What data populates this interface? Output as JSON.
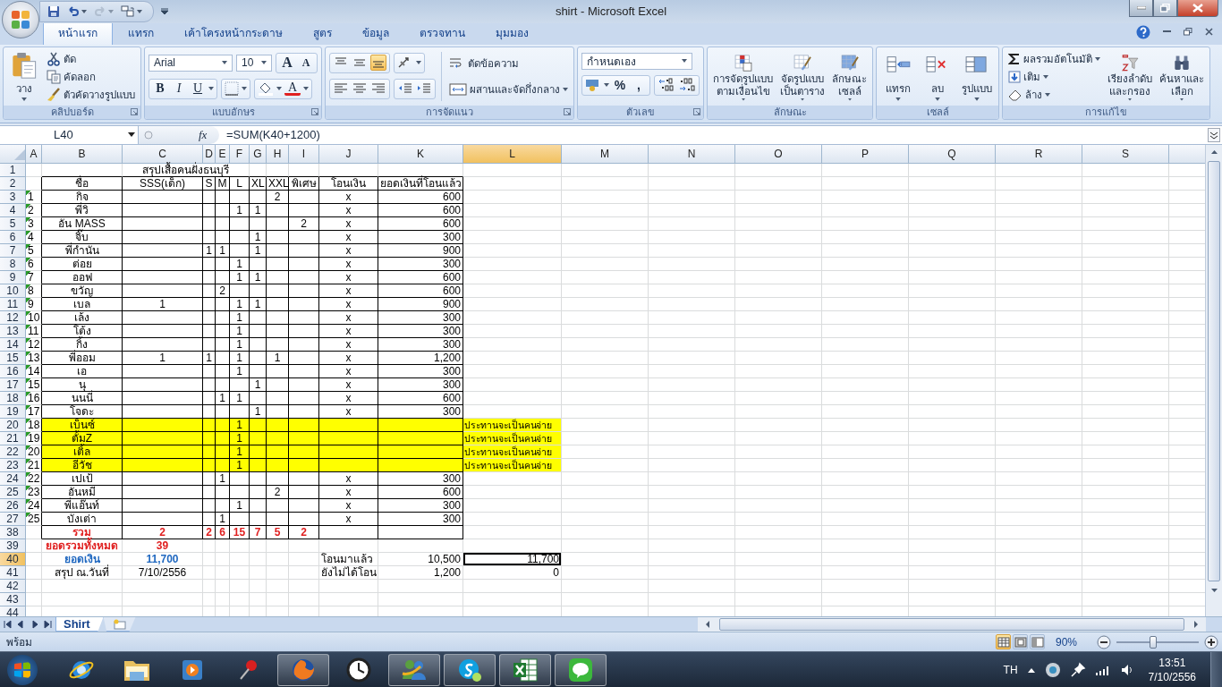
{
  "window": {
    "title": "shirt - Microsoft Excel"
  },
  "quick_access": [
    {
      "disabled": false
    },
    {
      "disabled": false
    },
    {
      "disabled": true
    },
    {
      "disabled": false
    }
  ],
  "tabs": [
    {
      "label": "หน้าแรก",
      "selected": true
    },
    {
      "label": "แทรก",
      "selected": false
    },
    {
      "label": "เค้าโครงหน้ากระดาษ",
      "selected": false
    },
    {
      "label": "สูตร",
      "selected": false
    },
    {
      "label": "ข้อมูล",
      "selected": false
    },
    {
      "label": "ตรวจทาน",
      "selected": false
    },
    {
      "label": "มุมมอง",
      "selected": false
    }
  ],
  "ribbon": {
    "groups": [
      {
        "kind": "clipboard",
        "label": "คลิปบอร์ด",
        "launcher": true,
        "paste": "วาง",
        "items": [
          "ตัด",
          "คัดลอก",
          "ตัวคัดวางรูปแบบ"
        ]
      },
      {
        "kind": "font",
        "label": "แบบอักษร",
        "launcher": true,
        "font": "Arial",
        "size": "10",
        "grow": "A",
        "shrink": "A",
        "styles": [
          "B",
          "I",
          "U"
        ],
        "color_letter": "A"
      },
      {
        "kind": "alignment",
        "label": "การจัดแนว",
        "launcher": true,
        "vertical": [
          {
            "selected": false
          },
          {
            "selected": false
          },
          {
            "selected": true
          }
        ],
        "wrap": "ตัดข้อความ",
        "merge": "ผสานและจัดกึ่งกลาง"
      },
      {
        "kind": "number",
        "label": "ตัวเลข",
        "launcher": true,
        "format": "กำหนดเอง",
        "percent": "%",
        "comma": ","
      },
      {
        "kind": "styles",
        "label": "ลักษณะ",
        "launcher": false,
        "buttons": [
          [
            "การจัดรูปแบบ",
            "ตามเงื่อนไข"
          ],
          [
            "จัดรูปแบบ",
            "เป็นตาราง"
          ],
          [
            "ลักษณะ",
            "เซลล์"
          ]
        ]
      },
      {
        "kind": "cells",
        "label": "เซลล์",
        "launcher": false,
        "buttons": [
          "แทรก",
          "ลบ",
          "รูปแบบ"
        ]
      },
      {
        "kind": "editing",
        "label": "การแก้ไข",
        "launcher": false,
        "items": [
          "ผลรวมอัตโนมัติ",
          "เติม",
          "ล้าง"
        ],
        "buttons": [
          [
            "เรียงลำดับ",
            "และกรอง"
          ],
          [
            "ค้นหาและ",
            "เลือก"
          ]
        ]
      }
    ]
  },
  "formula_bar": {
    "name_box": "L40",
    "function_label": "fx",
    "formula": "=SUM(K40+1200)"
  },
  "sheet": {
    "columns": [
      {
        "label": "A",
        "selected": false
      },
      {
        "label": "B",
        "selected": false
      },
      {
        "label": "C",
        "selected": false
      },
      {
        "label": "D",
        "selected": false
      },
      {
        "label": "E",
        "selected": false
      },
      {
        "label": "F",
        "selected": false
      },
      {
        "label": "G",
        "selected": false
      },
      {
        "label": "H",
        "selected": false
      },
      {
        "label": "I",
        "selected": false
      },
      {
        "label": "J",
        "selected": false
      },
      {
        "label": "K",
        "selected": false
      },
      {
        "label": "L",
        "selected": true
      },
      {
        "label": "M",
        "selected": false
      },
      {
        "label": "N",
        "selected": false
      },
      {
        "label": "O",
        "selected": false
      },
      {
        "label": "P",
        "selected": false
      },
      {
        "label": "Q",
        "selected": false
      },
      {
        "label": "R",
        "selected": false
      },
      {
        "label": "S",
        "selected": false
      }
    ],
    "rows": [
      {
        "number": "1",
        "kind": "title",
        "selected": false,
        "cells": {
          "C": "สรุปเสื้อคนฝั่งธนบุรี"
        }
      },
      {
        "number": "2",
        "kind": "heading",
        "selected": false,
        "cells": {
          "B": "ชื่อ",
          "C": "SSS(เด็ก)",
          "D": "S",
          "E": "M",
          "F": "L",
          "G": "XL",
          "H": "XXL",
          "I": "พิเศษ",
          "J": "โอนเงิน",
          "K": "ยอดเงินที่โอนแล้ว"
        }
      },
      {
        "number": "3",
        "kind": "member",
        "selected": false,
        "cells": {
          "A": "1",
          "B": "กิจ",
          "H": "2",
          "J": "x",
          "K": "600"
        }
      },
      {
        "number": "4",
        "kind": "member",
        "selected": false,
        "cells": {
          "A": "2",
          "B": "พี่วิ",
          "F": "1",
          "G": "1",
          "J": "x",
          "K": "600"
        }
      },
      {
        "number": "5",
        "kind": "member",
        "selected": false,
        "cells": {
          "A": "3",
          "B": "อัน MASS",
          "I": "2",
          "J": "x",
          "K": "600"
        }
      },
      {
        "number": "6",
        "kind": "member",
        "selected": false,
        "cells": {
          "A": "4",
          "B": "จิ๊บ",
          "G": "1",
          "J": "x",
          "K": "300"
        }
      },
      {
        "number": "7",
        "kind": "member",
        "selected": false,
        "cells": {
          "A": "5",
          "B": "พี่กำนัน",
          "D": "1",
          "E": "1",
          "G": "1",
          "J": "x",
          "K": "900"
        }
      },
      {
        "number": "8",
        "kind": "member",
        "selected": false,
        "cells": {
          "A": "6",
          "B": "ต่อย",
          "F": "1",
          "J": "x",
          "K": "300"
        }
      },
      {
        "number": "9",
        "kind": "member",
        "selected": false,
        "cells": {
          "A": "7",
          "B": "ออฟ",
          "F": "1",
          "G": "1",
          "J": "x",
          "K": "600"
        }
      },
      {
        "number": "10",
        "kind": "member",
        "selected": false,
        "cells": {
          "A": "8",
          "B": "ขวัญ",
          "E": "2",
          "J": "x",
          "K": "600"
        }
      },
      {
        "number": "11",
        "kind": "member",
        "selected": false,
        "cells": {
          "A": "9",
          "B": "เบล",
          "C": "1",
          "F": "1",
          "G": "1",
          "J": "x",
          "K": "900"
        }
      },
      {
        "number": "12",
        "kind": "member",
        "selected": false,
        "cells": {
          "A": "10",
          "B": "เล้ง",
          "F": "1",
          "J": "x",
          "K": "300"
        }
      },
      {
        "number": "13",
        "kind": "member",
        "selected": false,
        "cells": {
          "A": "11",
          "B": "โต้ง",
          "F": "1",
          "J": "x",
          "K": "300"
        }
      },
      {
        "number": "14",
        "kind": "member",
        "selected": false,
        "cells": {
          "A": "12",
          "B": "กิ้ง",
          "F": "1",
          "J": "x",
          "K": "300"
        }
      },
      {
        "number": "15",
        "kind": "member",
        "selected": false,
        "cells": {
          "A": "13",
          "B": "พี่ออม",
          "C": "1",
          "D": "1",
          "F": "1",
          "H": "1",
          "J": "x",
          "K": "1,200"
        }
      },
      {
        "number": "16",
        "kind": "member",
        "selected": false,
        "cells": {
          "A": "14",
          "B": "เอ",
          "F": "1",
          "J": "x",
          "K": "300"
        }
      },
      {
        "number": "17",
        "kind": "member",
        "selected": false,
        "cells": {
          "A": "15",
          "B": "นุ",
          "G": "1",
          "J": "x",
          "K": "300"
        }
      },
      {
        "number": "18",
        "kind": "member",
        "selected": false,
        "cells": {
          "A": "16",
          "B": "นนนี่",
          "E": "1",
          "F": "1",
          "J": "x",
          "K": "600"
        }
      },
      {
        "number": "19",
        "kind": "member",
        "selected": false,
        "cells": {
          "A": "17",
          "B": "โจดะ",
          "G": "1",
          "J": "x",
          "K": "300"
        }
      },
      {
        "number": "20",
        "kind": "sponsored",
        "selected": false,
        "cells": {
          "A": "18",
          "B": "เบ็นซ์",
          "F": "1",
          "L": "ประทานจะเป็นคนจ่าย"
        }
      },
      {
        "number": "21",
        "kind": "sponsored",
        "selected": false,
        "cells": {
          "A": "19",
          "B": "ตั้มZ",
          "F": "1",
          "L": "ประทานจะเป็นคนจ่าย"
        }
      },
      {
        "number": "22",
        "kind": "sponsored",
        "selected": false,
        "cells": {
          "A": "20",
          "B": "เติ้ล",
          "F": "1",
          "L": "ประทานจะเป็นคนจ่าย"
        }
      },
      {
        "number": "23",
        "kind": "sponsored",
        "selected": false,
        "cells": {
          "A": "21",
          "B": "อีวัช",
          "F": "1",
          "L": "ประทานจะเป็นคนจ่าย"
        }
      },
      {
        "number": "24",
        "kind": "member",
        "selected": false,
        "cells": {
          "A": "22",
          "B": "เปเป้",
          "E": "1",
          "J": "x",
          "K": "300"
        }
      },
      {
        "number": "25",
        "kind": "member",
        "selected": false,
        "cells": {
          "A": "23",
          "B": "อันหมี",
          "H": "2",
          "J": "x",
          "K": "600"
        }
      },
      {
        "number": "26",
        "kind": "member",
        "selected": false,
        "cells": {
          "A": "24",
          "B": "พี่แอ๊นท์",
          "F": "1",
          "J": "x",
          "K": "300"
        }
      },
      {
        "number": "27",
        "kind": "member",
        "selected": false,
        "cells": {
          "A": "25",
          "B": "บังเต่า",
          "E": "1",
          "J": "x",
          "K": "300"
        }
      },
      {
        "number": "38",
        "kind": "total",
        "selected": false,
        "cells": {
          "B": "รวม",
          "C": "2",
          "D": "2",
          "E": "6",
          "F": "15",
          "G": "7",
          "H": "5",
          "I": "2"
        }
      },
      {
        "number": "39",
        "kind": "grand",
        "selected": false,
        "cells": {
          "B": "ยอดรวมทั้งหมด",
          "C": "39"
        }
      },
      {
        "number": "40",
        "kind": "amount",
        "selected": true,
        "cells": {
          "B": "ยอดเงิน",
          "C": "11,700",
          "J": "โอนมาแล้ว",
          "K": "10,500",
          "L": "11,700"
        }
      },
      {
        "number": "41",
        "kind": "plain",
        "selected": false,
        "cells": {
          "B": "สรุป ณ.วันที่",
          "C": "7/10/2556",
          "J": "ยังไม่ได้โอน",
          "K": "1,200",
          "L": "0"
        }
      },
      {
        "number": "42",
        "kind": "blank",
        "selected": false,
        "cells": {}
      },
      {
        "number": "43",
        "kind": "blank",
        "selected": false,
        "cells": {}
      },
      {
        "number": "44",
        "kind": "blank",
        "selected": false,
        "cells": {}
      }
    ]
  },
  "sheet_tabs": [
    {
      "label": "Shirt",
      "selected": true
    }
  ],
  "status_bar": {
    "text": "พร้อม",
    "views": [
      {
        "selected": true
      },
      {
        "selected": false
      },
      {
        "selected": false
      }
    ],
    "zoom": {
      "reading": "90%",
      "level": 0.45
    }
  },
  "taskbar": {
    "apps": [
      {
        "running": false
      },
      {
        "running": false
      },
      {
        "running": false
      },
      {
        "running": false
      },
      {
        "running": true
      },
      {
        "running": false
      },
      {
        "running": true
      },
      {
        "running": true
      },
      {
        "running": true
      },
      {
        "running": true
      }
    ],
    "language": "TH",
    "time": "13:51",
    "date": "7/10/2556"
  }
}
